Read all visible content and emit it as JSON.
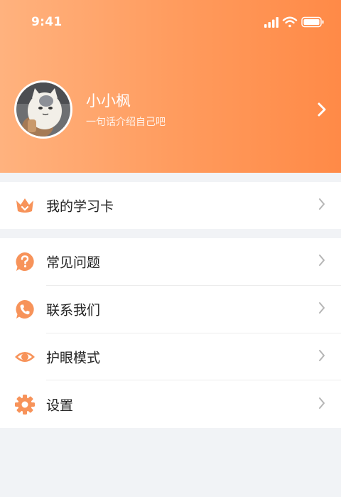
{
  "status_bar": {
    "time": "9:41"
  },
  "profile": {
    "name": "小小枫",
    "bio": "一句话介绍自己吧"
  },
  "menu_primary": [
    {
      "label": "我的学习卡",
      "icon": "crown-icon"
    }
  ],
  "menu_secondary": [
    {
      "label": "常见问题",
      "icon": "question-icon"
    },
    {
      "label": "联系我们",
      "icon": "phone-chat-icon"
    },
    {
      "label": "护眼模式",
      "icon": "eye-icon"
    },
    {
      "label": "设置",
      "icon": "gear-icon"
    }
  ],
  "colors": {
    "accent": "#ff8a47",
    "header_start": "#ffb27e",
    "icon": "#f7935a",
    "page_bg": "#f1f3f6"
  }
}
